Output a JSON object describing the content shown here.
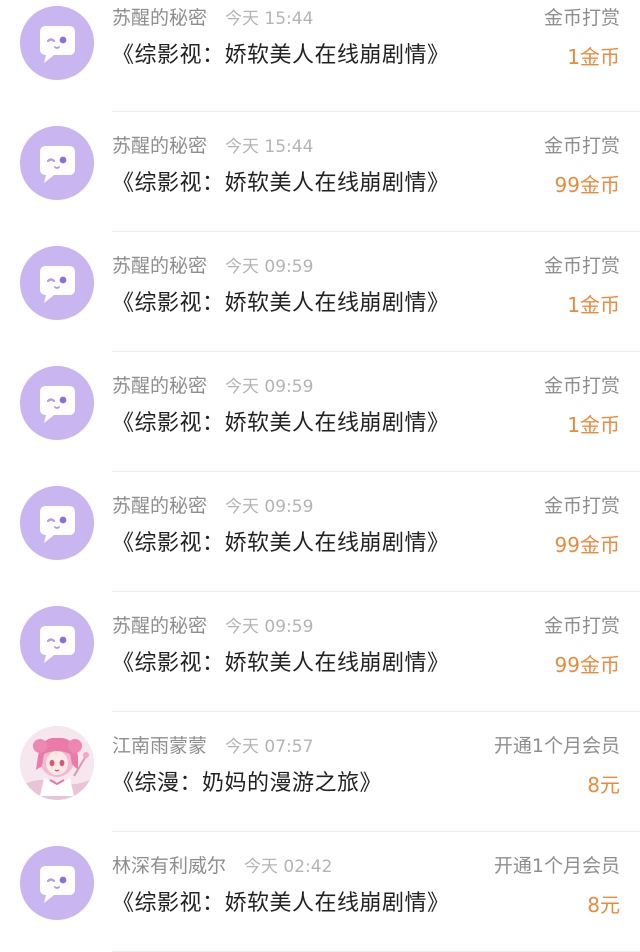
{
  "colors": {
    "accent_amount": "#ea8a3c",
    "avatar_purple": "#c9b6f1",
    "meta_gray": "#8e8e8e",
    "title_text": "#222222"
  },
  "records": [
    {
      "user": "苏醒的秘密",
      "time": "今天 15:44",
      "title": "《综影视：娇软美人在线崩剧情》",
      "action": "金币打赏",
      "amount": "1金币",
      "avatar_icon": "chat-bubble-face-icon"
    },
    {
      "user": "苏醒的秘密",
      "time": "今天 15:44",
      "title": "《综影视：娇软美人在线崩剧情》",
      "action": "金币打赏",
      "amount": "99金币",
      "avatar_icon": "chat-bubble-face-icon"
    },
    {
      "user": "苏醒的秘密",
      "time": "今天 09:59",
      "title": "《综影视：娇软美人在线崩剧情》",
      "action": "金币打赏",
      "amount": "1金币",
      "avatar_icon": "chat-bubble-face-icon"
    },
    {
      "user": "苏醒的秘密",
      "time": "今天 09:59",
      "title": "《综影视：娇软美人在线崩剧情》",
      "action": "金币打赏",
      "amount": "1金币",
      "avatar_icon": "chat-bubble-face-icon"
    },
    {
      "user": "苏醒的秘密",
      "time": "今天 09:59",
      "title": "《综影视：娇软美人在线崩剧情》",
      "action": "金币打赏",
      "amount": "99金币",
      "avatar_icon": "chat-bubble-face-icon"
    },
    {
      "user": "苏醒的秘密",
      "time": "今天 09:59",
      "title": "《综影视：娇软美人在线崩剧情》",
      "action": "金币打赏",
      "amount": "99金币",
      "avatar_icon": "chat-bubble-face-icon"
    },
    {
      "user": "江南雨蒙蒙",
      "time": "今天 07:57",
      "title": "《综漫：奶妈的漫游之旅》",
      "action": "开通1个月会员",
      "amount": "8元",
      "avatar_icon": "anime-girl-avatar"
    },
    {
      "user": "林深有利威尔",
      "time": "今天 02:42",
      "title": "《综影视：娇软美人在线崩剧情》",
      "action": "开通1个月会员",
      "amount": "8元",
      "avatar_icon": "chat-bubble-face-icon"
    }
  ]
}
